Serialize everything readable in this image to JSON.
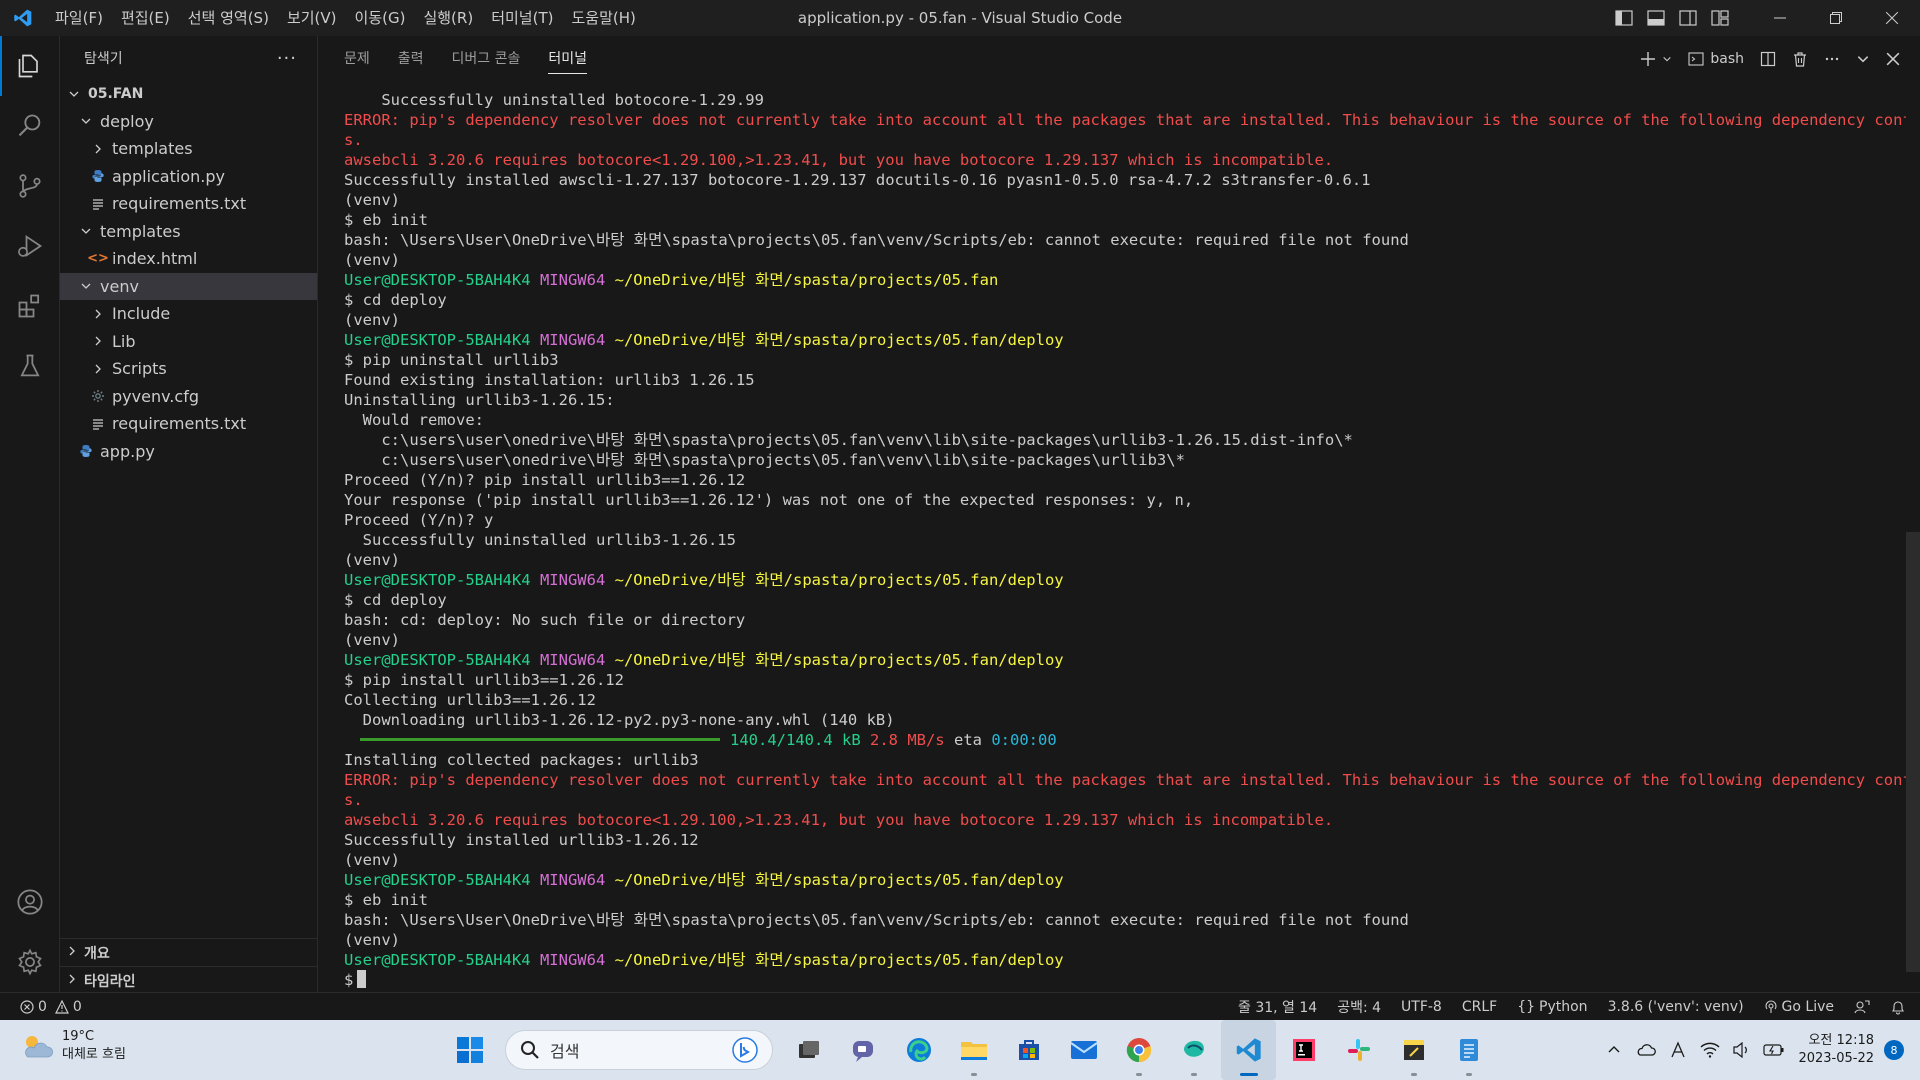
{
  "titlebar": {
    "menu": [
      "파일(F)",
      "편집(E)",
      "선택 영역(S)",
      "보기(V)",
      "이동(G)",
      "실행(R)",
      "터미널(T)",
      "도움말(H)"
    ],
    "window_title": "application.py - 05.fan - Visual Studio Code"
  },
  "sidebar": {
    "title": "탐색기",
    "more": "···",
    "root": "05.FAN",
    "tree": [
      {
        "label": "deploy",
        "indent": 1,
        "kind": "folder-open"
      },
      {
        "label": "templates",
        "indent": 2,
        "kind": "folder-closed"
      },
      {
        "label": "application.py",
        "indent": 2,
        "kind": "python"
      },
      {
        "label": "requirements.txt",
        "indent": 2,
        "kind": "text"
      },
      {
        "label": "templates",
        "indent": 1,
        "kind": "folder-open"
      },
      {
        "label": "index.html",
        "indent": 2,
        "kind": "html"
      },
      {
        "label": "venv",
        "indent": 1,
        "kind": "folder-open",
        "selected": true
      },
      {
        "label": "Include",
        "indent": 2,
        "kind": "folder-closed"
      },
      {
        "label": "Lib",
        "indent": 2,
        "kind": "folder-closed"
      },
      {
        "label": "Scripts",
        "indent": 2,
        "kind": "folder-closed"
      },
      {
        "label": "pyvenv.cfg",
        "indent": 2,
        "kind": "gear"
      },
      {
        "label": "requirements.txt",
        "indent": 2,
        "kind": "text"
      },
      {
        "label": "app.py",
        "indent": 1,
        "kind": "python"
      }
    ],
    "outline": "개요",
    "timeline": "타임라인"
  },
  "panel": {
    "tabs": [
      {
        "label": "문제",
        "active": false
      },
      {
        "label": "출력",
        "active": false
      },
      {
        "label": "디버그 콘솔",
        "active": false
      },
      {
        "label": "터미널",
        "active": true
      }
    ],
    "shell_label": "bash"
  },
  "terminal": {
    "lines": [
      [
        {
          "t": "    Successfully uninstalled botocore-1.29.99",
          "c": "default"
        }
      ],
      [
        {
          "t": "ERROR: pip's dependency resolver does not currently take into account all the packages that are installed. This behaviour is the source of the following dependency conflict",
          "c": "red"
        }
      ],
      [
        {
          "t": "s.",
          "c": "red"
        }
      ],
      [
        {
          "t": "awsebcli 3.20.6 requires botocore<1.29.100,>1.23.41, but you have botocore 1.29.137 which is incompatible.",
          "c": "red"
        }
      ],
      [
        {
          "t": "Successfully installed awscli-1.27.137 botocore-1.29.137 docutils-0.16 pyasn1-0.5.0 rsa-4.7.2 s3transfer-0.6.1",
          "c": "default"
        }
      ],
      [
        {
          "t": "(venv)",
          "c": "default"
        }
      ],
      [
        {
          "t": "$ eb init",
          "c": "default"
        }
      ],
      [
        {
          "t": "bash: \\Users\\User\\OneDrive\\바탕 화면\\spasta\\projects\\05.fan\\venv/Scripts/eb: cannot execute: required file not found",
          "c": "default"
        }
      ],
      [
        {
          "t": "(venv)",
          "c": "default"
        }
      ],
      [
        {
          "t": "User@DESKTOP-5BAH4K4",
          "c": "green"
        },
        {
          "t": " MINGW64",
          "c": "magenta"
        },
        {
          "t": " ~/OneDrive/바탕 화면/spasta/projects/05.fan",
          "c": "yellow"
        }
      ],
      [
        {
          "t": "$ cd deploy",
          "c": "default"
        }
      ],
      [
        {
          "t": "(venv)",
          "c": "default"
        }
      ],
      [
        {
          "t": "User@DESKTOP-5BAH4K4",
          "c": "green"
        },
        {
          "t": " MINGW64",
          "c": "magenta"
        },
        {
          "t": " ~/OneDrive/바탕 화면/spasta/projects/05.fan/deploy",
          "c": "yellow"
        }
      ],
      [
        {
          "t": "$ pip uninstall urllib3",
          "c": "default"
        }
      ],
      [
        {
          "t": "Found existing installation: urllib3 1.26.15",
          "c": "default"
        }
      ],
      [
        {
          "t": "Uninstalling urllib3-1.26.15:",
          "c": "default"
        }
      ],
      [
        {
          "t": "  Would remove:",
          "c": "default"
        }
      ],
      [
        {
          "t": "    c:\\users\\user\\onedrive\\바탕 화면\\spasta\\projects\\05.fan\\venv\\lib\\site-packages\\urllib3-1.26.15.dist-info\\*",
          "c": "default"
        }
      ],
      [
        {
          "t": "    c:\\users\\user\\onedrive\\바탕 화면\\spasta\\projects\\05.fan\\venv\\lib\\site-packages\\urllib3\\*",
          "c": "default"
        }
      ],
      [
        {
          "t": "Proceed (Y/n)? pip install urllib3==1.26.12",
          "c": "default"
        }
      ],
      [
        {
          "t": "Your response ('pip install urllib3==1.26.12') was not one of the expected responses: y, n,",
          "c": "default"
        }
      ],
      [
        {
          "t": "Proceed (Y/n)? y",
          "c": "default"
        }
      ],
      [
        {
          "t": "  Successfully uninstalled urllib3-1.26.15",
          "c": "default"
        }
      ],
      [
        {
          "t": "(venv)",
          "c": "default"
        }
      ],
      [
        {
          "t": "User@DESKTOP-5BAH4K4",
          "c": "green"
        },
        {
          "t": " MINGW64",
          "c": "magenta"
        },
        {
          "t": " ~/OneDrive/바탕 화면/spasta/projects/05.fan/deploy",
          "c": "yellow"
        }
      ],
      [
        {
          "t": "$ cd deploy",
          "c": "default"
        }
      ],
      [
        {
          "t": "bash: cd: deploy: No such file or directory",
          "c": "default"
        }
      ],
      [
        {
          "t": "(venv)",
          "c": "default"
        }
      ],
      [
        {
          "t": "User@DESKTOP-5BAH4K4",
          "c": "green"
        },
        {
          "t": " MINGW64",
          "c": "magenta"
        },
        {
          "t": " ~/OneDrive/바탕 화면/spasta/projects/05.fan/deploy",
          "c": "yellow"
        }
      ],
      [
        {
          "t": "$ pip install urllib3==1.26.12",
          "c": "default"
        }
      ],
      [
        {
          "t": "Collecting urllib3==1.26.12",
          "c": "default"
        }
      ],
      [
        {
          "t": "  Downloading urllib3-1.26.12-py2.py3-none-any.whl (140 kB)",
          "c": "default"
        }
      ],
      [
        {
          "progress": true
        },
        {
          "t": "140.4/140.4 kB",
          "c": "green"
        },
        {
          "t": " 2.8 MB/s",
          "c": "red"
        },
        {
          "t": " eta ",
          "c": "default"
        },
        {
          "t": "0:00:00",
          "c": "cyan"
        }
      ],
      [
        {
          "t": "Installing collected packages: urllib3",
          "c": "default"
        }
      ],
      [
        {
          "t": "ERROR: pip's dependency resolver does not currently take into account all the packages that are installed. This behaviour is the source of the following dependency conflict",
          "c": "red"
        }
      ],
      [
        {
          "t": "s.",
          "c": "red"
        }
      ],
      [
        {
          "t": "awsebcli 3.20.6 requires botocore<1.29.100,>1.23.41, but you have botocore 1.29.137 which is incompatible.",
          "c": "red"
        }
      ],
      [
        {
          "t": "Successfully installed urllib3-1.26.12",
          "c": "default"
        }
      ],
      [
        {
          "t": "(venv)",
          "c": "default"
        }
      ],
      [
        {
          "t": "User@DESKTOP-5BAH4K4",
          "c": "green"
        },
        {
          "t": " MINGW64",
          "c": "magenta"
        },
        {
          "t": " ~/OneDrive/바탕 화면/spasta/projects/05.fan/deploy",
          "c": "yellow"
        }
      ],
      [
        {
          "t": "$ eb init",
          "c": "default"
        }
      ],
      [
        {
          "t": "bash: \\Users\\User\\OneDrive\\바탕 화면\\spasta\\projects\\05.fan\\venv/Scripts/eb: cannot execute: required file not found",
          "c": "default"
        }
      ],
      [
        {
          "t": "(venv)",
          "c": "default"
        }
      ],
      [
        {
          "t": "User@DESKTOP-5BAH4K4",
          "c": "green"
        },
        {
          "t": " MINGW64",
          "c": "magenta"
        },
        {
          "t": " ~/OneDrive/바탕 화면/spasta/projects/05.fan/deploy",
          "c": "yellow"
        }
      ],
      [
        {
          "t": "$",
          "c": "default"
        },
        {
          "cursor": true
        }
      ]
    ],
    "download_progress": 1.0
  },
  "statusbar": {
    "errors": "0",
    "warnings": "0",
    "position": "줄 31, 열 14",
    "spaces": "공백: 4",
    "encoding": "UTF-8",
    "eol": "CRLF",
    "language": "Python",
    "interpreter": "3.8.6 ('venv': venv)",
    "golive": "Go Live"
  },
  "taskbar": {
    "temperature": "19°C",
    "weather": "대체로 흐림",
    "search_placeholder": "검색",
    "time": "오전 12:18",
    "date": "2023-05-22",
    "notifications": "8"
  },
  "colors": {
    "accent": "#0078d4",
    "terminal_red": "#f14c4c",
    "terminal_green": "#23d18b",
    "terminal_magenta": "#d670d6",
    "terminal_yellow": "#f5f543"
  }
}
